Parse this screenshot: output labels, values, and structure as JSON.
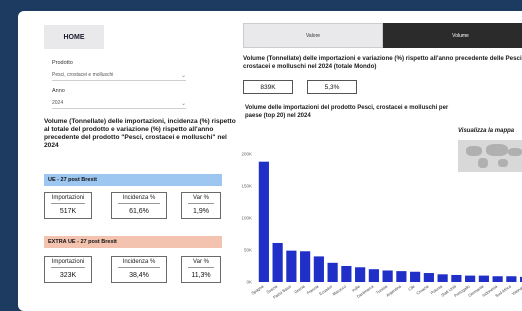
{
  "nav": {
    "home_label": "HOME"
  },
  "filters": {
    "prodotto_label": "Prodotto",
    "prodotto_value": "Pesci, crostacei e molluschi",
    "anno_label": "Anno",
    "anno_value": "2024"
  },
  "left": {
    "title": "Volume (Tonnellate) delle importazioni, incidenza (%) rispetto al totale del prodotto e variazione (%) rispetto all'anno precedente del prodotto \"Pesci, crostacei e molluschi\" nel 2024",
    "groups": [
      {
        "label": "UE - 27 post Brexit",
        "kpis": [
          {
            "label": "Importazioni",
            "value": "517K"
          },
          {
            "label": "Incidenza %",
            "value": "61,6%"
          },
          {
            "label": "Var %",
            "value": "1,9%"
          }
        ]
      },
      {
        "label": "EXTRA UE - 27 post Brexit",
        "kpis": [
          {
            "label": "Importazioni",
            "value": "323K"
          },
          {
            "label": "Incidenza %",
            "value": "38,4%"
          },
          {
            "label": "Var %",
            "value": "11,3%"
          }
        ]
      }
    ]
  },
  "tabs": {
    "valore": "Valore",
    "volume": "Volume"
  },
  "right": {
    "title": "Volume (Tonnellate) delle importazioni e variazione (%) rispetto all'anno precedente delle Pesci, crostacei e molluschi nel 2024 (totale Mondo)",
    "total_value": "839K",
    "total_var": "5,3%",
    "chart_title": "Volume delle importazioni del prodotto Pesci, crostacei e molluschi per paese (top 20) nel 2024",
    "map_link": "Visualizza la mappa"
  },
  "colors": {
    "bar": "#1f2fc8",
    "ue_band": "#9dc7f0",
    "extra_band": "#f3c3b0",
    "background": "#1d3a60"
  },
  "chart_data": {
    "type": "bar",
    "title": "Volume delle importazioni del prodotto Pesci, crostacei e molluschi per paese (top 20) nel 2024",
    "categories": [
      "Spagna",
      "Svezia",
      "Paesi Bassi",
      "Grecia",
      "Francia",
      "Ecuador",
      "Marocco",
      "India",
      "Danimarca",
      "Tunisia",
      "Argentina",
      "Cile",
      "Croazia",
      "Polonia",
      "Stati Uniti",
      "Portogallo",
      "Germania",
      "Indonesia",
      "Sud Africa",
      "Vietnam"
    ],
    "values": [
      188000,
      61000,
      49000,
      48000,
      40000,
      30000,
      25000,
      23000,
      20000,
      18000,
      17000,
      16000,
      14000,
      12000,
      11000,
      10000,
      10000,
      9000,
      9000,
      8000
    ],
    "yticks": [
      "0K",
      "50K",
      "100K",
      "150K",
      "200K"
    ],
    "ylim": [
      0,
      200000
    ],
    "grid": false
  }
}
